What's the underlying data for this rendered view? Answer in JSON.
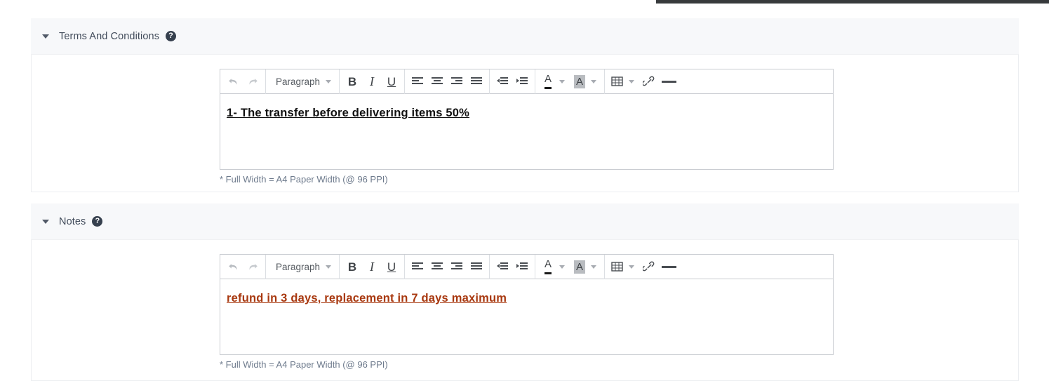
{
  "page": {
    "top_strip_color": "#373a3c",
    "background": "#ffffff"
  },
  "sections": [
    {
      "id": "terms-and-conditions",
      "title": "Terms And Conditions",
      "help_icon": "question-circle-icon",
      "collapsed": false,
      "editor": {
        "toolbar": {
          "undo": "undo-icon",
          "redo": "redo-icon",
          "style_select": "Paragraph",
          "bold": "B",
          "italic": "I",
          "underline": "U",
          "align_left": "align-left-icon",
          "align_center": "align-center-icon",
          "align_right": "align-right-icon",
          "align_justify": "align-justify-icon",
          "outdent": "outdent-icon",
          "indent": "indent-icon",
          "text_color": "A",
          "highlight_color": "A",
          "table": "table-icon",
          "link": "link-icon",
          "horizontal_rule": "horizontal-rule-icon"
        },
        "content": "1- The transfer before delivering items 50%",
        "content_color": "#111111",
        "note": "* Full Width = A4 Paper Width (@ 96 PPI)"
      }
    },
    {
      "id": "notes",
      "title": "Notes",
      "help_icon": "question-circle-icon",
      "collapsed": false,
      "editor": {
        "toolbar": {
          "undo": "undo-icon",
          "redo": "redo-icon",
          "style_select": "Paragraph",
          "bold": "B",
          "italic": "I",
          "underline": "U",
          "align_left": "align-left-icon",
          "align_center": "align-center-icon",
          "align_right": "align-right-icon",
          "align_justify": "align-justify-icon",
          "outdent": "outdent-icon",
          "indent": "indent-icon",
          "text_color": "A",
          "highlight_color": "A",
          "table": "table-icon",
          "link": "link-icon",
          "horizontal_rule": "horizontal-rule-icon"
        },
        "content": "refund in 3 days, replacement in 7 days maximum",
        "content_color": "#a8380f",
        "note": "* Full Width = A4 Paper Width (@ 96 PPI)"
      }
    }
  ],
  "help_glyph": "?"
}
